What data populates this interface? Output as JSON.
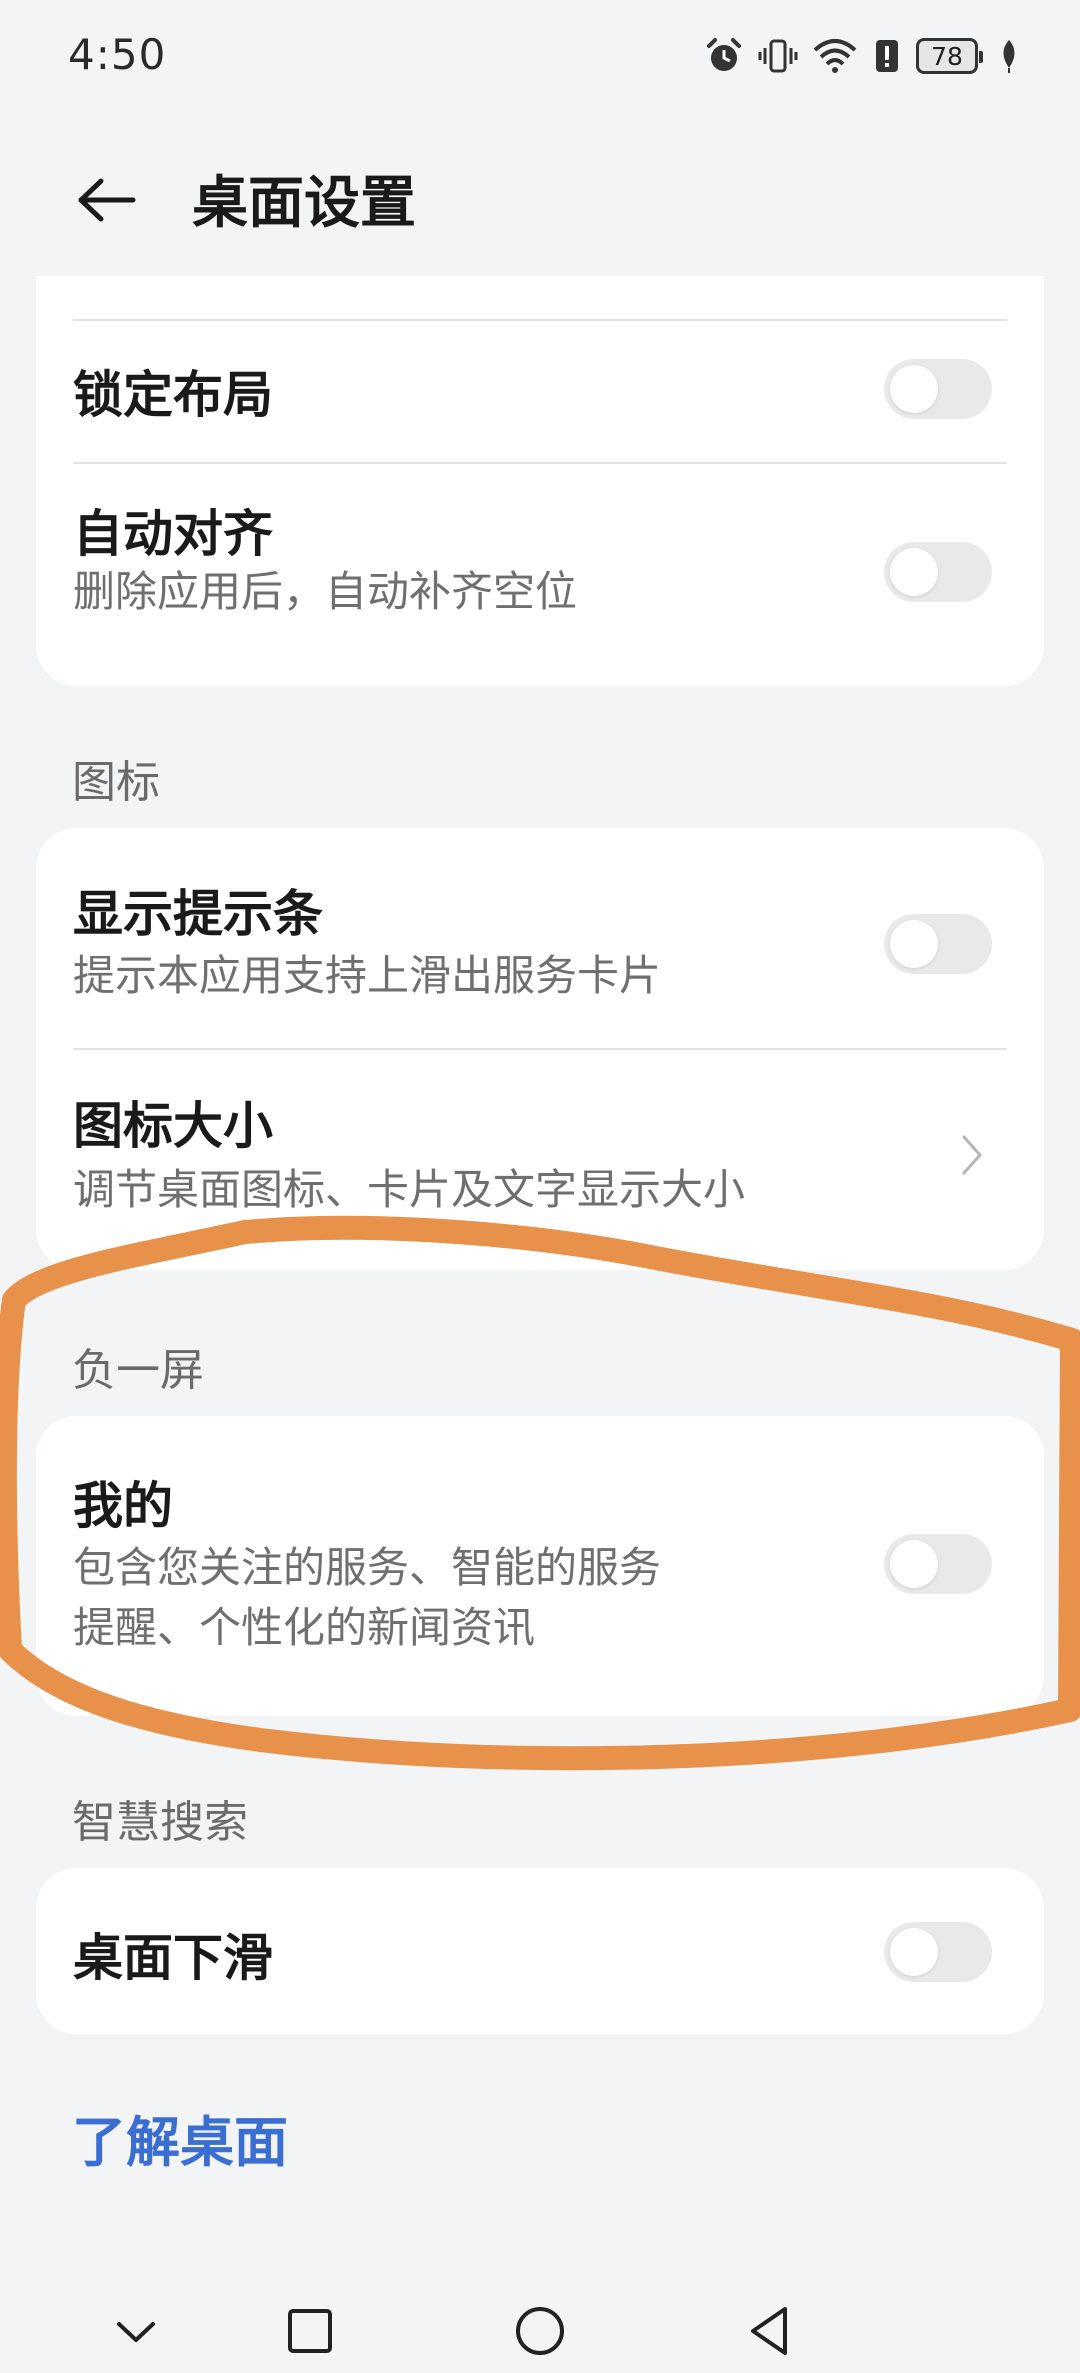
{
  "status_bar": {
    "time": "4:50",
    "battery": "78",
    "icons": [
      "alarm-icon",
      "vibrate-icon",
      "wifi-icon",
      "battery-saver-icon",
      "battery-icon",
      "leaf-icon"
    ]
  },
  "header": {
    "title": "桌面设置",
    "back_icon": "back-arrow-icon"
  },
  "layout_card": {
    "items": [
      {
        "title": "锁定布局",
        "toggle": false
      },
      {
        "title": "自动对齐",
        "subtitle": "删除应用后，自动补齐空位",
        "toggle": false
      }
    ]
  },
  "icon_section": {
    "label": "图标",
    "items": [
      {
        "title": "显示提示条",
        "subtitle": "提示本应用支持上滑出服务卡片",
        "toggle": false
      },
      {
        "title": "图标大小",
        "subtitle": "调节桌面图标、卡片及文字显示大小",
        "chevron": "chevron-right-icon"
      }
    ]
  },
  "minus_one_section": {
    "label": "负一屏",
    "items": [
      {
        "title": "我的",
        "subtitle": "包含您关注的服务、智能的服务\n提醒、个性化的新闻资讯",
        "toggle": false
      }
    ]
  },
  "search_section": {
    "label": "智慧搜索",
    "items": [
      {
        "title": "桌面下滑",
        "toggle": false
      }
    ]
  },
  "link": {
    "label": "了解桌面"
  },
  "annotation": {
    "color": "#e8914b",
    "shape": "hand-drawn loop around 负一屏 section"
  },
  "nav_bar": {
    "icons": [
      "collapse-chevron-icon",
      "recents-square-icon",
      "home-circle-icon",
      "back-triangle-icon"
    ]
  },
  "colors": {
    "background": "#f3f4f6",
    "card": "#ffffff",
    "link": "#3b6ed1",
    "toggle_off": "#e9e9e9",
    "annotation": "#e8914b"
  }
}
